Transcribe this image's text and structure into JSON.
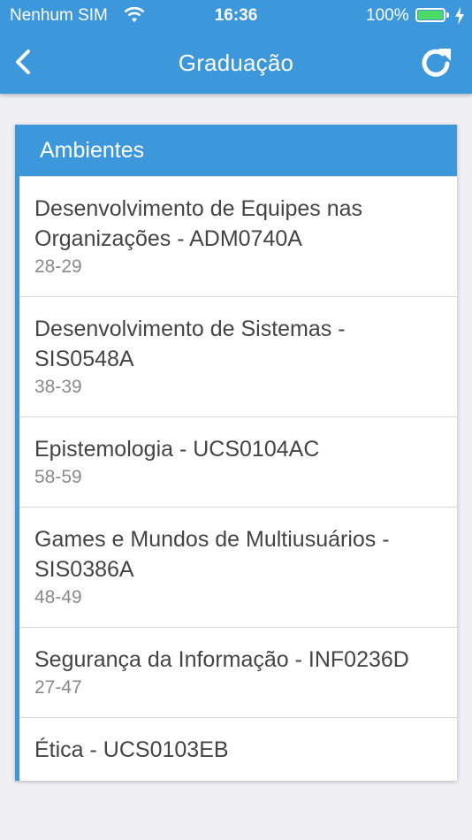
{
  "status_bar": {
    "carrier": "Nenhum SIM",
    "time": "16:36",
    "battery": "100%"
  },
  "nav": {
    "title": "Graduação",
    "back_icon": "chevron-left-icon",
    "refresh_icon": "refresh-icon"
  },
  "section": {
    "header": "Ambientes",
    "items": [
      {
        "title": "Desenvolvimento de Equipes nas Organizações - ADM0740A",
        "subtitle": "28-29"
      },
      {
        "title": "Desenvolvimento de Sistemas - SIS0548A",
        "subtitle": "38-39"
      },
      {
        "title": "Epistemologia - UCS0104AC",
        "subtitle": "58-59"
      },
      {
        "title": "Games e Mundos de Multiusuários - SIS0386A",
        "subtitle": "48-49"
      },
      {
        "title": "Segurança da Informação - INF0236D",
        "subtitle": "27-47"
      },
      {
        "title": "Ética - UCS0103EB",
        "subtitle": ""
      }
    ]
  },
  "colors": {
    "primary": "#3c98db",
    "background": "#efeff4",
    "battery": "#4cd964"
  }
}
